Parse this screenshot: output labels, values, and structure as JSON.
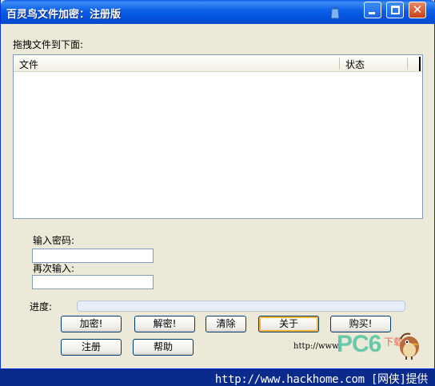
{
  "window": {
    "title": "百灵鸟文件加密：注册版"
  },
  "filelist": {
    "drag_label": "拖拽文件到下面:",
    "columns": [
      "文件",
      "状态"
    ],
    "rows": []
  },
  "password": {
    "label": "输入密码:",
    "value": ""
  },
  "confirm": {
    "label": "再次输入:",
    "value": ""
  },
  "progress": {
    "label": "进度:",
    "fraction": 0
  },
  "buttons": {
    "encrypt": "加密!",
    "decrypt": "解密!",
    "clear": "清除",
    "about": "关于",
    "buy": "购买!",
    "register": "注册",
    "help": "帮助"
  },
  "branding": {
    "url": "http://www.",
    "watermark": "PC6",
    "watermark_sub": "下载",
    "footer": "http://www.hackhome.com [网侠]提供"
  },
  "icons": {
    "title_icon": "paper-bag-icon",
    "mascot": "bird-icon"
  },
  "colors": {
    "titlebar": "#0a5fe6",
    "footer": "#0a2a8c",
    "progress_fill": "#3cb85c"
  }
}
